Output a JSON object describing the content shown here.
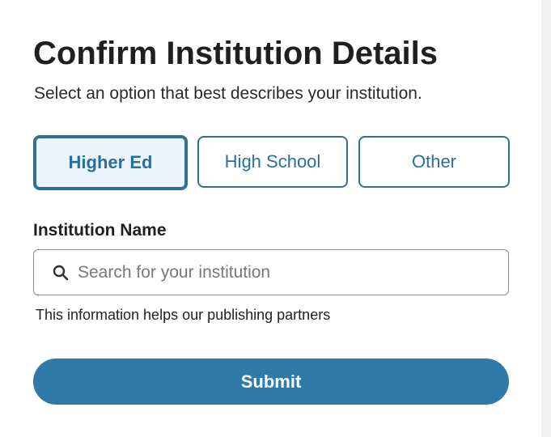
{
  "header": {
    "title": "Confirm Institution Details",
    "subtitle": "Select an option that best describes your institution."
  },
  "institution_types": {
    "selected": "Higher Ed",
    "options": [
      {
        "label": "Higher Ed",
        "selected": true
      },
      {
        "label": "High School",
        "selected": false
      },
      {
        "label": "Other",
        "selected": false
      }
    ]
  },
  "institution_name": {
    "label": "Institution Name",
    "placeholder": "Search for your institution",
    "value": "",
    "icon": "search-icon",
    "helper": "This information helps our publishing partners"
  },
  "submit": {
    "label": "Submit"
  },
  "colors": {
    "accent": "#2f7aa8",
    "selected_bg": "#eaf4fc",
    "border": "#2f6f9a"
  }
}
